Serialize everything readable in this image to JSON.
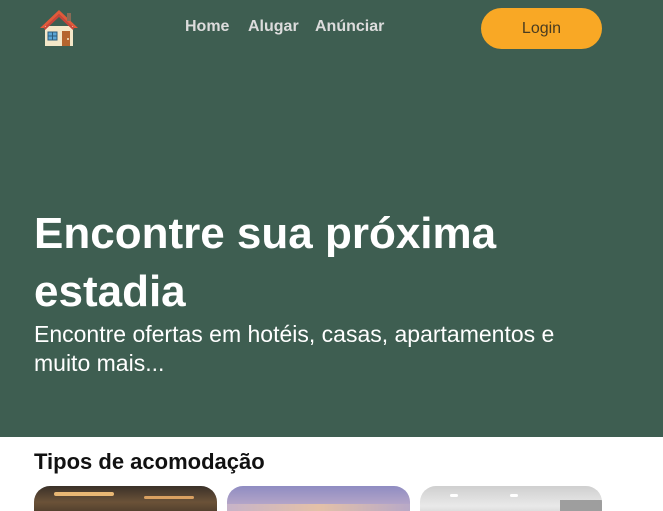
{
  "nav": {
    "home": "Home",
    "rent": "Alugar",
    "advertise": "Anúnciar"
  },
  "login": {
    "label": "Login"
  },
  "hero": {
    "title": "Encontre sua próxima estadia",
    "subtitle": "Encontre ofertas em hotéis, casas, apartamentos e muito mais..."
  },
  "accommodation": {
    "title": "Tipos de acomodação"
  },
  "colors": {
    "hero_bg": "#3e5e51",
    "accent": "#f9a825"
  }
}
